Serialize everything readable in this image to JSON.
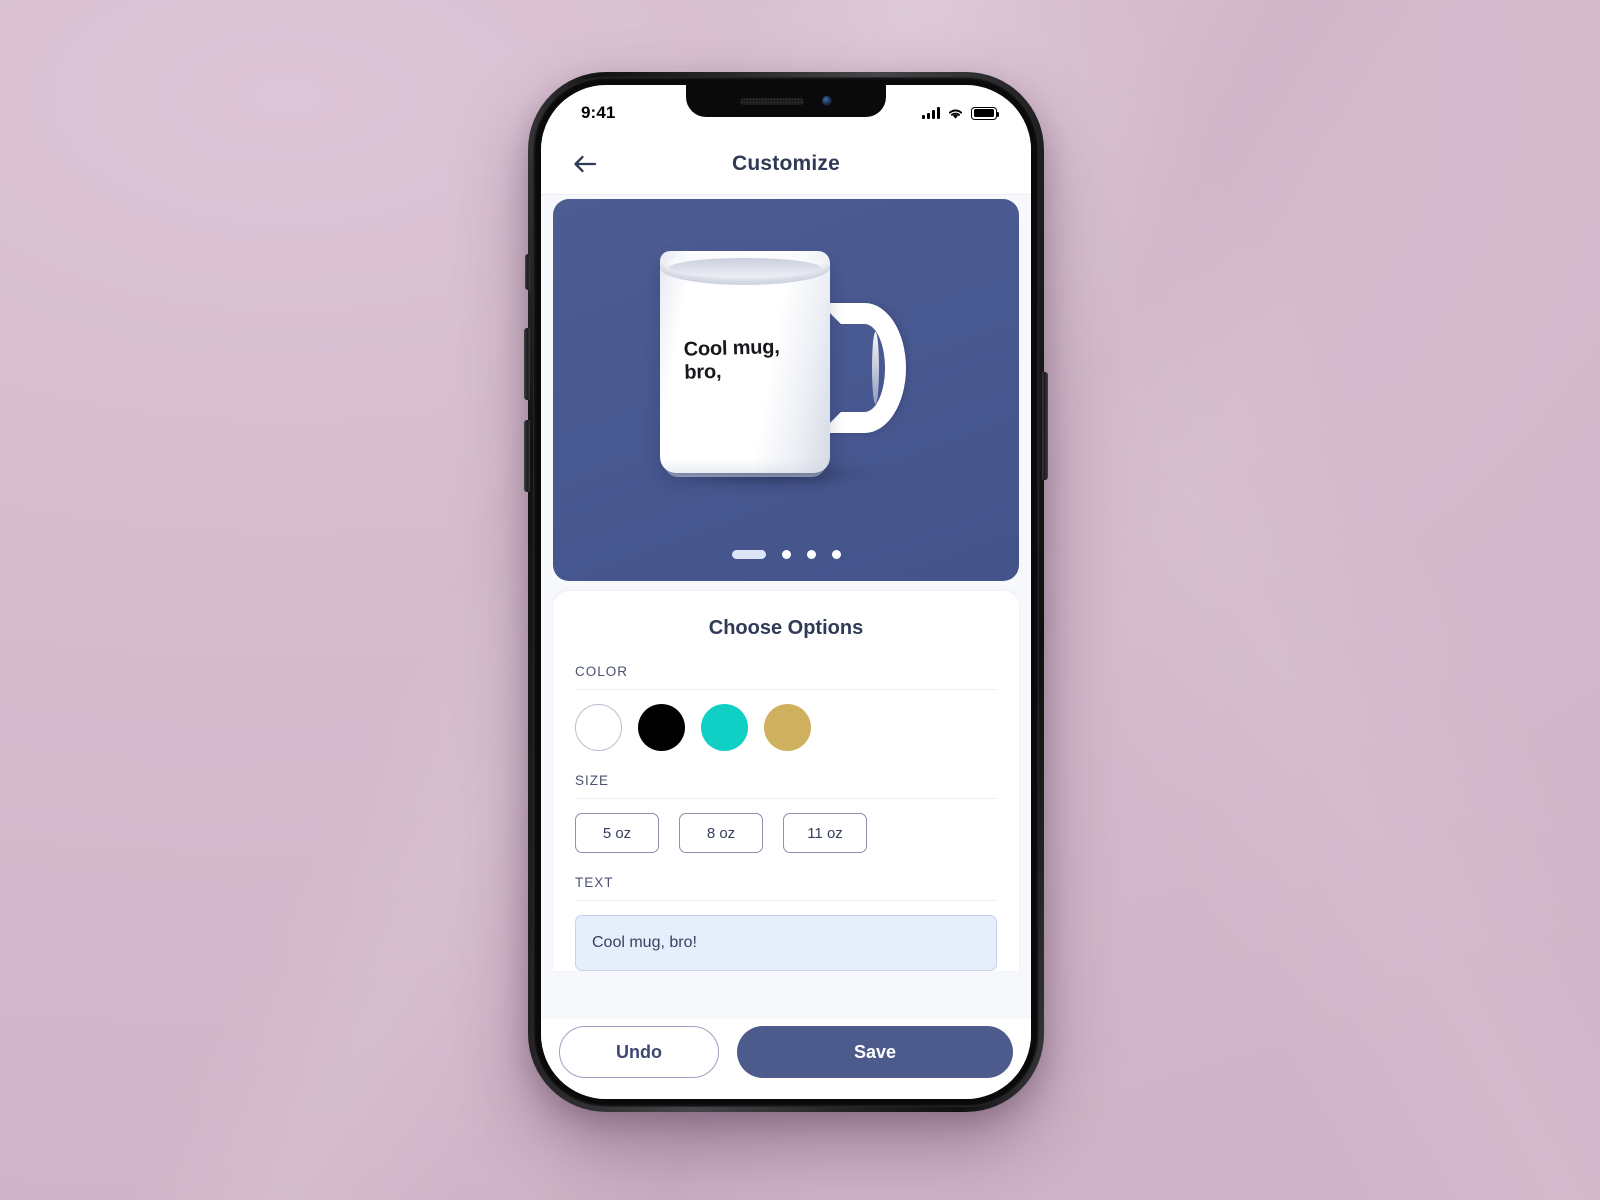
{
  "status_bar": {
    "time": "9:41",
    "signal_icon": "cellular-signal-icon",
    "wifi_icon": "wifi-icon",
    "battery_icon": "battery-full-icon"
  },
  "header": {
    "back_icon": "back-arrow-icon",
    "title": "Customize"
  },
  "hero": {
    "background_color": "#485890",
    "mug_text": "Cool mug,\nbro,",
    "carousel": {
      "total": 4,
      "active_index": 0,
      "active_color": "#dce6f7",
      "inactive_color": "#ffffff"
    }
  },
  "options": {
    "title": "Choose Options",
    "color": {
      "label": "COLOR",
      "swatches": [
        {
          "name": "white",
          "hex": "#ffffff",
          "outlined": true
        },
        {
          "name": "black",
          "hex": "#000000",
          "outlined": false
        },
        {
          "name": "teal",
          "hex": "#10cfc5",
          "outlined": false
        },
        {
          "name": "gold",
          "hex": "#cfb05f",
          "outlined": false
        }
      ]
    },
    "size": {
      "label": "SIZE",
      "chips": [
        "5 oz",
        "8 oz",
        "11 oz"
      ]
    },
    "text": {
      "label": "TEXT",
      "value": "Cool mug, bro!",
      "placeholder": "Cool mug, bro!"
    }
  },
  "footer": {
    "undo_label": "Undo",
    "save_label": "Save",
    "save_color": "#4d5b8c"
  }
}
